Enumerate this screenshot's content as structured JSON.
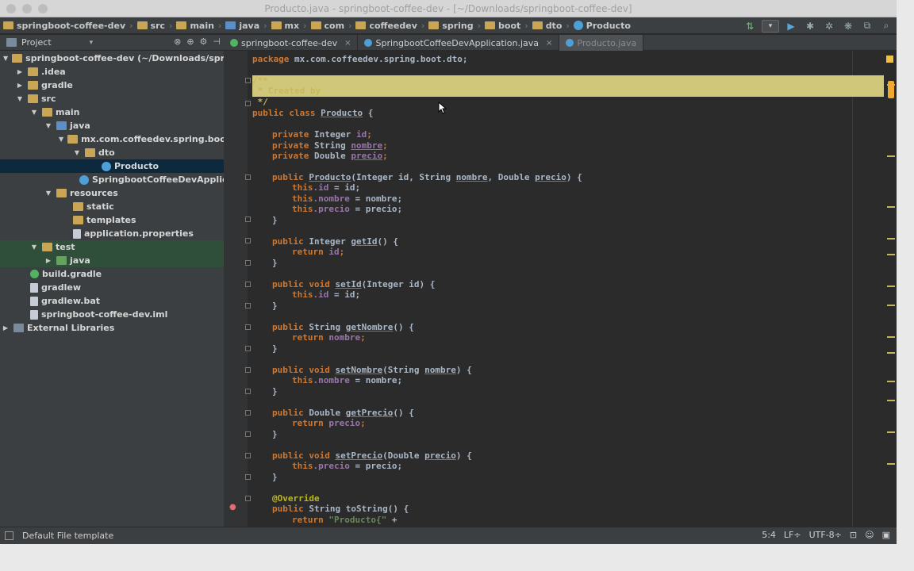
{
  "window": {
    "title": "Producto.java - springboot-coffee-dev - [~/Downloads/springboot-coffee-dev]"
  },
  "breadcrumb": [
    "springboot-coffee-dev",
    "src",
    "main",
    "java",
    "mx",
    "com",
    "coffeedev",
    "spring",
    "boot",
    "dto",
    "Producto"
  ],
  "project_panel": {
    "title": "Project"
  },
  "tabs": [
    {
      "label": "springboot-coffee-dev",
      "close": "×"
    },
    {
      "label": "SpringbootCoffeeDevApplication.java",
      "close": "×"
    },
    {
      "label": "Producto.java",
      "close": ""
    }
  ],
  "tree": [
    {
      "label": "springboot-coffee-dev (~/Downloads/spring",
      "arrow": "▼",
      "icon": "folder-icon"
    },
    {
      "label": ".idea",
      "arrow": "▶",
      "icon": "folder-icon"
    },
    {
      "label": "gradle",
      "arrow": "▶",
      "icon": "folder-icon"
    },
    {
      "label": "src",
      "arrow": "▼",
      "icon": "folder-icon"
    },
    {
      "label": "main",
      "arrow": "▼",
      "icon": "folder-icon"
    },
    {
      "label": "java",
      "arrow": "▼",
      "icon": "source-folder-icon"
    },
    {
      "label": "mx.com.coffeedev.spring.boot",
      "arrow": "▼",
      "icon": "package-icon"
    },
    {
      "label": "dto",
      "arrow": "▼",
      "icon": "package-icon"
    },
    {
      "label": "Producto",
      "arrow": "",
      "icon": "class-icon"
    },
    {
      "label": "SpringbootCoffeeDevApplic",
      "arrow": "",
      "icon": "class-icon"
    },
    {
      "label": "resources",
      "arrow": "▼",
      "icon": "folder-icon"
    },
    {
      "label": "static",
      "arrow": "",
      "icon": "folder-icon"
    },
    {
      "label": "templates",
      "arrow": "",
      "icon": "folder-icon"
    },
    {
      "label": "application.properties",
      "arrow": "",
      "icon": "file-icon"
    },
    {
      "label": "test",
      "arrow": "▼",
      "icon": "test-folder-icon"
    },
    {
      "label": "java",
      "arrow": "▶",
      "icon": "test-source-folder-icon"
    },
    {
      "label": "build.gradle",
      "arrow": "",
      "icon": "gradle-icon"
    },
    {
      "label": "gradlew",
      "arrow": "",
      "icon": "file-icon"
    },
    {
      "label": "gradlew.bat",
      "arrow": "",
      "icon": "file-icon"
    },
    {
      "label": "springboot-coffee-dev.iml",
      "arrow": "",
      "icon": "module-file-icon"
    },
    {
      "label": "External Libraries",
      "arrow": "▶",
      "icon": "library-icon"
    }
  ],
  "code": {
    "package_kw": "package",
    "package_name": " mx.com.coffeedev.spring.boot.dto;",
    "javadoc_open": "/**",
    "javadoc_line": " * Created by ",
    "javadoc_close": " */",
    "class_decl_kw": "public class ",
    "class_name": "Producto",
    "class_brace": " {",
    "f1_kw": "private ",
    "f1_type": "Integer ",
    "f1_name": "id",
    "f2_kw": "private ",
    "f2_type": "String ",
    "f2_name": "nombre",
    "f3_kw": "private ",
    "f3_type": "Double ",
    "f3_name": "precio",
    "semi": ";",
    "ctor_kw": "public ",
    "ctor_name": "Producto",
    "ctor_args": "(Integer id, String ",
    "ctor_arg2": "nombre",
    "ctor_args2": ", Double ",
    "ctor_arg3": "precio",
    "ctor_end": ") {",
    "this": "this",
    "a1_field": ".id",
    "a1_rest": " = id;",
    "a2_field": ".nombre",
    "a2_rest": " = nombre;",
    "a3_field": ".precio",
    "a3_rest": " = precio;",
    "close": "}",
    "m1_kw": "public ",
    "m1_type": "Integer ",
    "m1_name": "getId",
    "m1_sig": "() {",
    "ret": "return ",
    "m2_kw": "public void ",
    "m2_name": "setId",
    "m2_sig": "(Integer id) {",
    "m3_kw": "public ",
    "m3_type": "String ",
    "m3_name": "getNombre",
    "m3_sig": "() {",
    "m4_kw": "public void ",
    "m4_name": "setNombre",
    "m4_sig1": "(String ",
    "m4_arg": "nombre",
    "m4_sig2": ") {",
    "m5_kw": "public ",
    "m5_type": "Double ",
    "m5_name": "getPrecio",
    "m5_sig": "() {",
    "m6_kw": "public void ",
    "m6_name": "setPrecio",
    "m6_sig1": "(Double ",
    "m6_arg": "precio",
    "m6_sig2": ") {",
    "override": "@Override",
    "m7_kw": "public ",
    "m7_type": "String ",
    "m7_name": "toString",
    "m7_sig": "() {",
    "ret_str": "\"Producto{\"",
    "plus": " +"
  },
  "status": {
    "message": "Default File template",
    "position": "5:4",
    "line_sep": "LF÷",
    "encoding": "UTF-8÷"
  },
  "colors": {
    "keyword": "#cc7832",
    "field": "#9876aa",
    "annotation": "#bbb529",
    "string": "#6a8759",
    "highlight": "#d1c77a"
  }
}
